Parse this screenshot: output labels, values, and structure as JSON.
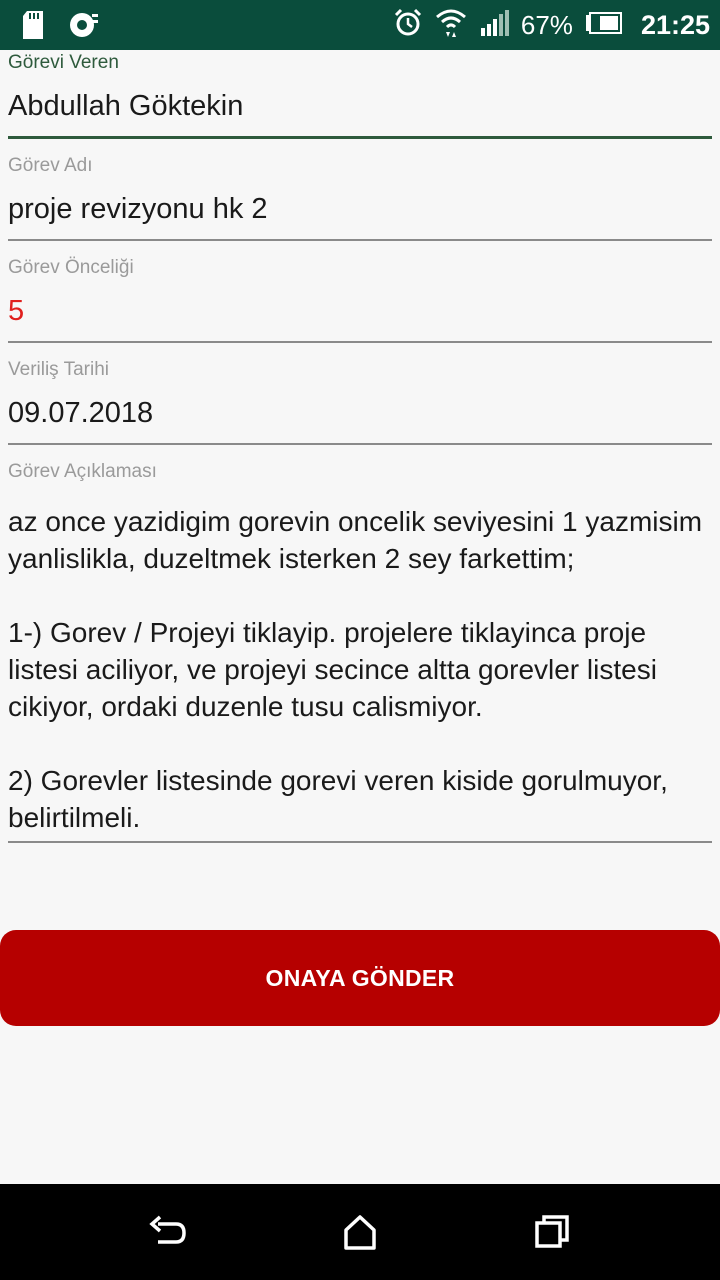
{
  "status_bar": {
    "battery_percent": "67%",
    "time": "21:25",
    "icons": [
      "sd-card-icon",
      "sync-icon",
      "alarm-icon",
      "wifi-icon",
      "signal-icon",
      "battery-icon"
    ]
  },
  "form": {
    "assigner": {
      "label": "Görevi Veren",
      "value": "Abdullah Göktekin"
    },
    "task_name": {
      "label": "Görev Adı",
      "value": "proje revizyonu hk 2"
    },
    "priority": {
      "label": "Görev Önceliği",
      "value": "5",
      "color": "#e0201e"
    },
    "date": {
      "label": "Veriliş Tarihi",
      "value": "09.07.2018"
    },
    "description": {
      "label": "Görev Açıklaması",
      "value": "az once yazidigim gorevin oncelik seviyesini 1 yazmisim yanlislikla, duzeltmek isterken 2 sey farkettim;\n\n1-) Gorev / Projeyi tiklayip. projelere tiklayinca proje listesi aciliyor, ve projeyi secince altta gorevler listesi cikiyor, ordaki duzenle tusu calismiyor.\n\n2) Gorevler listesinde gorevi veren kiside gorulmuyor, belirtilmeli."
    }
  },
  "submit_button": {
    "label": "ONAYA GÖNDER",
    "color": "#b60000"
  },
  "theme": {
    "status_bar": "#0a4d3c",
    "accent": "#2e5a3c"
  },
  "nav_bar": {
    "icons": [
      "back-icon",
      "home-icon",
      "recents-icon"
    ]
  }
}
